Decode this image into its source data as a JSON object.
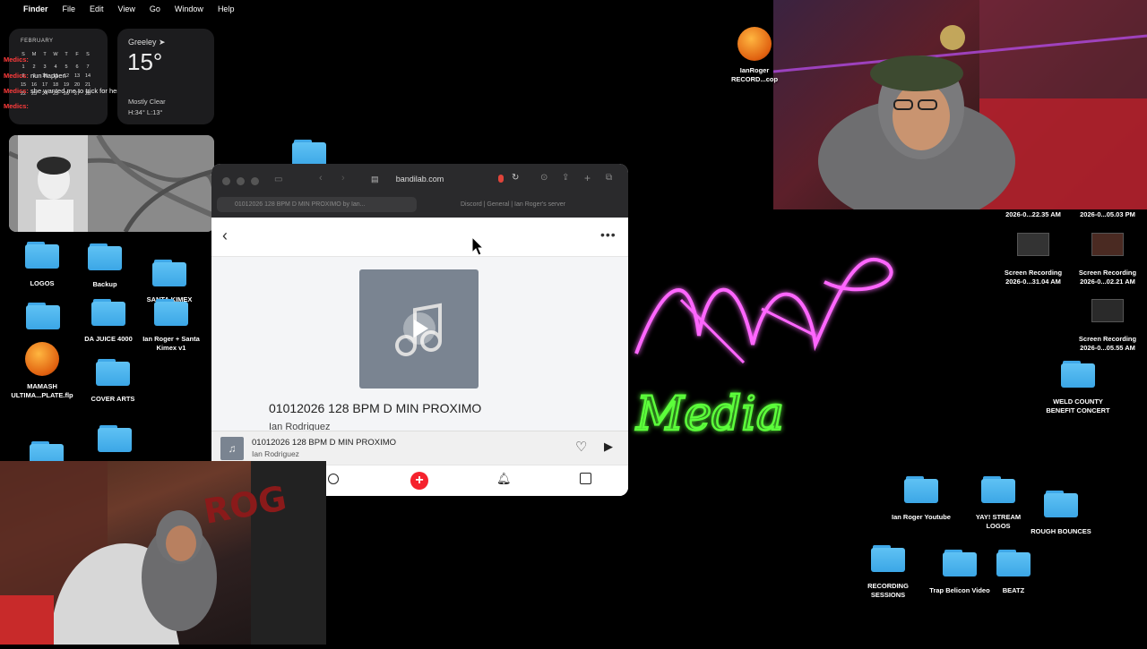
{
  "menubar": {
    "app": "Finder",
    "items": [
      "File",
      "Edit",
      "View",
      "Go",
      "Window",
      "Help"
    ]
  },
  "calendar_widget": {
    "month": "FEBRUARY",
    "weekdays": [
      "S",
      "M",
      "T",
      "W",
      "T",
      "F",
      "S"
    ],
    "days": [
      "",
      "",
      "",
      "",
      "",
      "",
      "",
      "1",
      "2",
      "3",
      "4",
      "5",
      "6",
      "7",
      "8",
      "9",
      "10",
      "11",
      "12",
      "13",
      "14",
      "15",
      "16",
      "17",
      "18",
      "19",
      "20",
      "21",
      "22",
      "23",
      "24",
      "25",
      "26",
      "27",
      "28"
    ]
  },
  "chat_overlay": [
    {
      "user": "Medics:",
      "text": ""
    },
    {
      "user": "Medics:",
      "text": "nun happen"
    },
    {
      "user": "Medics:",
      "text": "she wanted me to trick for her but I said nah"
    },
    {
      "user": "Medics:",
      "text": ""
    }
  ],
  "weather_widget": {
    "city": "Greeley",
    "temp": "15°",
    "condition": "Mostly Clear",
    "range": "H:34° L:13°"
  },
  "left_desktop_items": [
    {
      "label": "LOGOS",
      "type": "folder"
    },
    {
      "label": "Backup",
      "type": "folder"
    },
    {
      "label": "SANTA KIMEX",
      "type": "folder"
    },
    {
      "label": "DA JUICE 4000",
      "type": "folder"
    },
    {
      "label": "Ian Roger + Santa Kimex v1",
      "type": "folder"
    },
    {
      "label": "MAMASH ULTIMA...PLATE.flp",
      "type": "flp"
    },
    {
      "label": "COVER ARTS",
      "type": "folder"
    }
  ],
  "browser": {
    "url": "bandilab.com",
    "tab1": "01012026 128 BPM D MIN PROXIMO by Ian...",
    "tab2": "Discord | General | Ian Roger's server",
    "track_title": "01012026 128 BPM D MIN PROXIMO",
    "artist": "Ian Rodriguez",
    "player_title": "01012026 128 BPM D MIN PROXIMO",
    "player_artist": "Ian Rodriguez"
  },
  "right_desktop_items": [
    {
      "label": "IanRoger RECORD...cop"
    },
    {
      "label": "2026-0...22.35 AM"
    },
    {
      "label": "2026-0...05.03 PM"
    },
    {
      "label": "Screen Recording 2026-0...31.04 AM"
    },
    {
      "label": "Screen Recording 2026-0...02.21 AM"
    },
    {
      "label": "Screen Recording 2026-0...05.55 AM"
    },
    {
      "label": "WELD COUNTY BENEFIT CONCERT"
    },
    {
      "label": "Ian Roger Youtube"
    },
    {
      "label": "YAY! STREAM LOGOS"
    },
    {
      "label": "ROUGH BOUNCES"
    },
    {
      "label": "RECORDING SESSIONS"
    },
    {
      "label": "Trap Belicon Video"
    },
    {
      "label": "BEATZ"
    }
  ],
  "colors": {
    "folder": "#4fb4ee",
    "neon_pink": "#ff4dff",
    "neon_green": "#39ff14",
    "bandlab_red": "#f5222d"
  }
}
